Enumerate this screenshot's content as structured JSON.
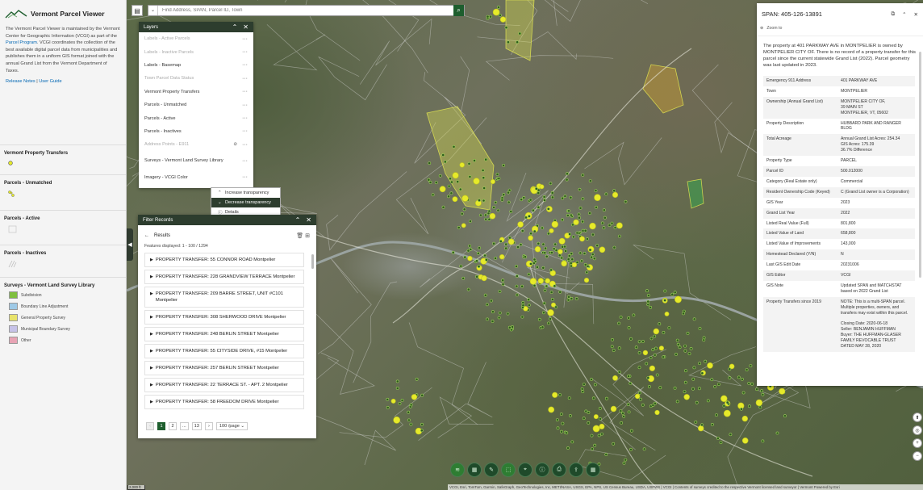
{
  "app": {
    "title": "Vermont Parcel Viewer",
    "intro_1": "The Vermont Parcel Viewer is maintained by the Vermont Center for Geographic Information (VCGI) as part of the ",
    "intro_link": "Parcel Program",
    "intro_2": ". VCGI coordinates the collection of the best available digital parcel data from municipalities and publishes them in a uniform GIS format joined with the annual Grand List from the Vermont Department of Taxes.",
    "release_notes": "Release Notes",
    "separator": " | ",
    "user_guide": "User Guide"
  },
  "legend": {
    "sections": [
      {
        "title": "Vermont Property Transfers",
        "symbol": "dot"
      },
      {
        "title": "Parcels - Unmatched",
        "symbol": "dots"
      },
      {
        "title": "Parcels - Active",
        "symbol": "outline"
      },
      {
        "title": "Parcels - Inactives",
        "symbol": "hatch"
      }
    ],
    "surveys_title": "Surveys - Vermont Land Survey Library",
    "surveys_items": [
      {
        "label": "Subdivision",
        "color": "#7fbf3f"
      },
      {
        "label": "Boundary Line Adjustment",
        "color": "#9ec9e6"
      },
      {
        "label": "General Property Survey",
        "color": "#e8e36b"
      },
      {
        "label": "Municipal Boundary Survey",
        "color": "#c6c2e8"
      },
      {
        "label": "Other",
        "color": "#e7a3b4"
      }
    ]
  },
  "search": {
    "placeholder": "Find Address, SPAN, Parcel ID, Town"
  },
  "layers_panel": {
    "title": "Layers",
    "items": [
      {
        "label": "Labels - Active Parcels",
        "dim": true
      },
      {
        "label": "Labels - Inactive Parcels",
        "dim": true
      },
      {
        "label": "Labels - Basemap",
        "dim": false
      },
      {
        "label": "Town Parcel Data Status",
        "dim": true
      },
      {
        "label": "Vermont Property Transfers",
        "dim": false
      },
      {
        "label": "Parcels - Unmatched",
        "dim": false
      },
      {
        "label": "Parcels - Active",
        "dim": false
      },
      {
        "label": "Parcels - Inactives",
        "dim": false
      },
      {
        "label": "Address Points - E911",
        "dim": true
      },
      {
        "label": "Surveys - Vermont Land Survey Library",
        "dim": false
      },
      {
        "label": "Imagery - VCGI Color",
        "dim": false
      }
    ],
    "context_menu": [
      "Increase transparency",
      "Decrease transparency",
      "Details"
    ]
  },
  "filter_panel": {
    "title": "Filter Records",
    "results_label": "Results",
    "features_displayed": "Features displayed: 1 - 100 / 1294",
    "records": [
      "PROPERTY TRANSFER: 55 CONNOR ROAD Montpelier",
      "PROPERTY TRANSFER: 228 GRANDVIEW TERRACE Montpelier",
      "PROPERTY TRANSFER: 209 BARRE STREET, UNIT #C101 Montpelier",
      "PROPERTY TRANSFER: 308 SHERWOOD DRIVE Montpelier",
      "PROPERTY TRANSFER: 248 BERLIN STREET Montpelier",
      "PROPERTY TRANSFER: 55 CITYSIDE DRIVE, #15 Montpelier",
      "PROPERTY TRANSFER: 257 BERLIN STREET Montpelier",
      "PROPERTY TRANSFER: 22 TERRACE ST. - APT. 2 Montpelier",
      "PROPERTY TRANSFER: 58 FREEDOM DRIVE Montpelier"
    ],
    "pager": {
      "prev": "‹",
      "pages": [
        "1",
        "2",
        "...",
        "13"
      ],
      "next": "›",
      "per_page": "100",
      "per_page_label": "/page"
    }
  },
  "details_panel": {
    "title": "SPAN: 405-126-13891",
    "zoom_to": "Zoom to",
    "description": "The property at 401 PARKWAY AVE in MONTPELIER is owned by MONTPELIER CITY OF. There is no record of a property transfer for this parcel since the current statewide Grand List (2022). Parcel geometry was last updated in 2023.",
    "rows": [
      {
        "k": "Emergency 911 Address",
        "v": "401 PARKWAY AVE"
      },
      {
        "k": "Town",
        "v": "MONTPELIER"
      },
      {
        "k": "Ownership (Annual Grand List)",
        "v": "MONTPELIER CITY OF,\n39 MAIN ST\nMONTPELIER, VT, 05602"
      },
      {
        "k": "Property Description",
        "v": "HUBBARD PARK AND RANGER BLDG"
      },
      {
        "k": "Total Acreage",
        "v": "Annual Grand List Acres: 254.34\nGIS Acres: 175.39\n36.7% Difference"
      },
      {
        "k": "Property Type",
        "v": "PARCEL"
      },
      {
        "k": "Parcel ID",
        "v": "500.012000"
      },
      {
        "k": "Category (Real Estate only)",
        "v": "Commercial"
      },
      {
        "k": "Resident Ownership Code (Keyed)",
        "v": "C (Grand List owner is a Corporation)"
      },
      {
        "k": "GIS Year",
        "v": "2023"
      },
      {
        "k": "Grand List Year",
        "v": "2022"
      },
      {
        "k": "Listed Real Value (Full)",
        "v": "801,800"
      },
      {
        "k": "Listed Value of Land",
        "v": "658,800"
      },
      {
        "k": "Listed Value of Improvements",
        "v": "143,000"
      },
      {
        "k": "Homestead Declared (Y/N)",
        "v": "N"
      },
      {
        "k": "Last GIS Edit Date",
        "v": "20231006"
      },
      {
        "k": "GIS Editor",
        "v": "VCGI"
      },
      {
        "k": "GIS Note",
        "v": "Updated SPAN and MATCHSTAT based on 2022 Grand List"
      },
      {
        "k": "Property Transfers since 2019",
        "v": "NOTE: This is a multi-SPAN parcel. Multiple properties, owners, and transfers may exist within this parcel.\n\nClosing Date: 2020-06-18\nSeller: BENJAMIN HUFFMAN\nBuyer: THE HUFFMAN-GLASER FAMILY REVOCABLE TRUST\nDATED MAY 28, 2020"
      }
    ]
  },
  "map": {
    "scale_label": "2,000 ft",
    "attribution": "VCGI, Esri, TomTom, Garmin, SafeGraph, GeoTechnologies, Inc, METI/NASA, USGS, EPA, NPS, US Census Bureau, USDA, USFWS | VCGI | Contents of surveys credited to the respective Vermont licensed land surveyor | Vermont   Powered by Esri"
  },
  "colors": {
    "header_dark": "#2d3d2e",
    "accent_green": "#1e5e2e",
    "link": "#0066b3",
    "point_yellow": "#e6ea2a"
  }
}
